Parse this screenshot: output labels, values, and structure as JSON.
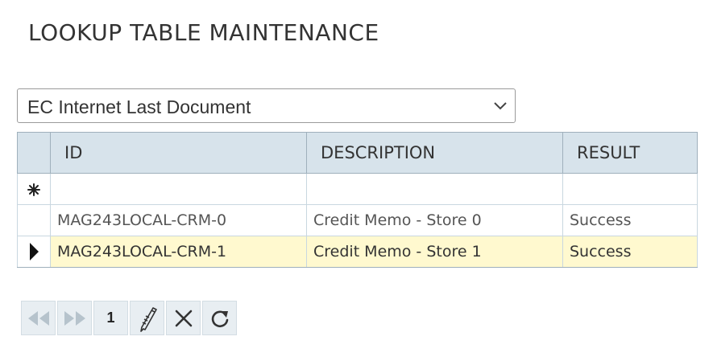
{
  "page": {
    "title": "LOOKUP TABLE MAINTENANCE"
  },
  "lookup_select": {
    "selected": "EC Internet Last Document",
    "chevron_icon": "chevron-down-icon"
  },
  "grid": {
    "columns": [
      "ID",
      "DESCRIPTION",
      "RESULT"
    ],
    "new_row_icon": "asterisk-icon",
    "current_row_icon": "row-pointer-icon",
    "rows": [
      {
        "id": "MAG243LOCAL-CRM-0",
        "description": "Credit Memo - Store 0",
        "result": "Success"
      },
      {
        "id": "MAG243LOCAL-CRM-1",
        "description": "Credit Memo - Store 1",
        "result": "Success"
      }
    ],
    "selected_row_color": "#fff9cf",
    "header_color": "#d7e3eb"
  },
  "pager": {
    "page_number": "1",
    "buttons": [
      "first-page-icon",
      "last-page-icon",
      "edit-icon",
      "delete-icon",
      "refresh-icon"
    ]
  }
}
